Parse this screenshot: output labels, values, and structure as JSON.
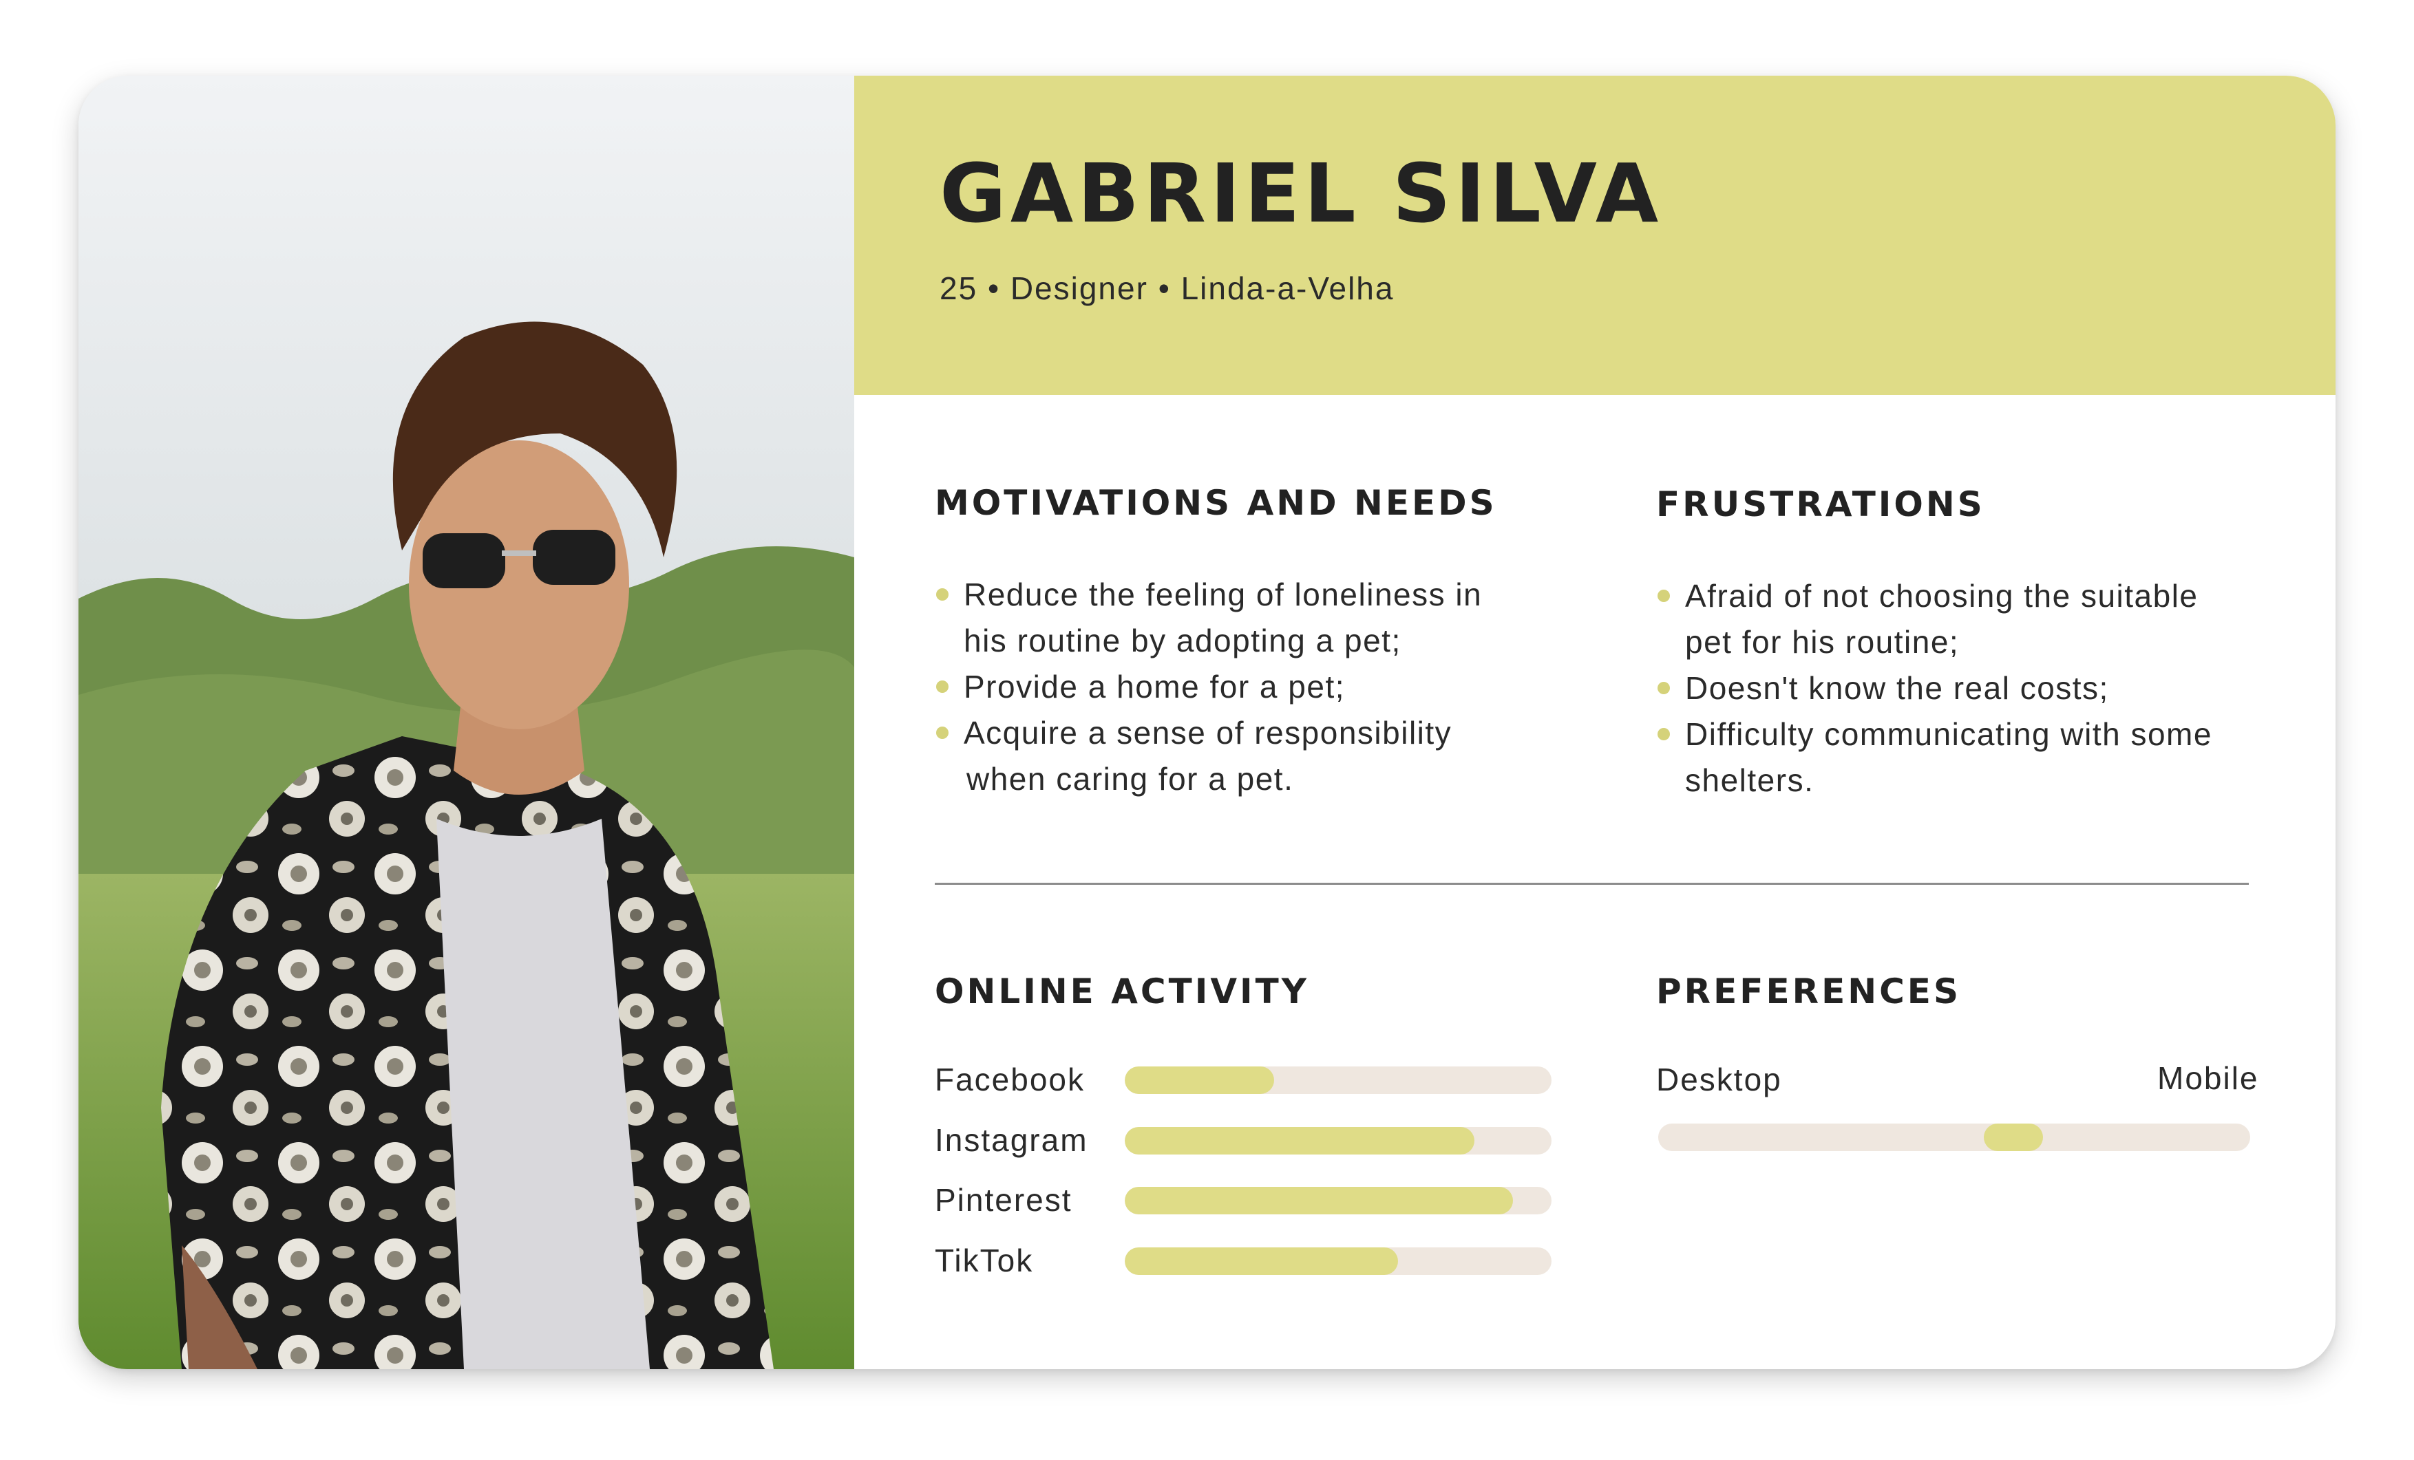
{
  "persona": {
    "name": "GABRIEL SILVA",
    "subtitle": "25 • Designer • Linda-a-Velha"
  },
  "motivations": {
    "title": "MOTIVATIONS AND NEEDS",
    "items": [
      {
        "line1": "Reduce the feeling of loneliness in",
        "line2": "his routine by adopting a pet;"
      },
      {
        "line1": "Provide a home for a pet;",
        "line2": ""
      },
      {
        "line1": "Acquire a sense of responsibility",
        "line2": "when caring for a pet."
      }
    ]
  },
  "frustrations": {
    "title": "FRUSTRATIONS",
    "items": [
      {
        "line1": "Afraid of not choosing the suitable",
        "line2": "pet for his routine;"
      },
      {
        "line1": "Doesn't know the real costs;",
        "line2": ""
      },
      {
        "line1": "Difficulty communicating with some",
        "line2": "shelters."
      }
    ]
  },
  "online_activity": {
    "title": "ONLINE ACTIVITY",
    "platforms": [
      {
        "label": "Facebook",
        "level": 0.35
      },
      {
        "label": "Instagram",
        "level": 0.82
      },
      {
        "label": "Pinterest",
        "level": 0.91
      },
      {
        "label": "TikTok",
        "level": 0.64
      }
    ]
  },
  "preferences": {
    "title": "PREFERENCES",
    "left_label": "Desktop",
    "right_label": "Mobile",
    "position": 0.6
  },
  "colors": {
    "accent": "#dfdc87",
    "track": "#efe7df",
    "text": "#222222",
    "divider": "#8c8c8c"
  },
  "images": {
    "photo": "portrait-photo"
  }
}
